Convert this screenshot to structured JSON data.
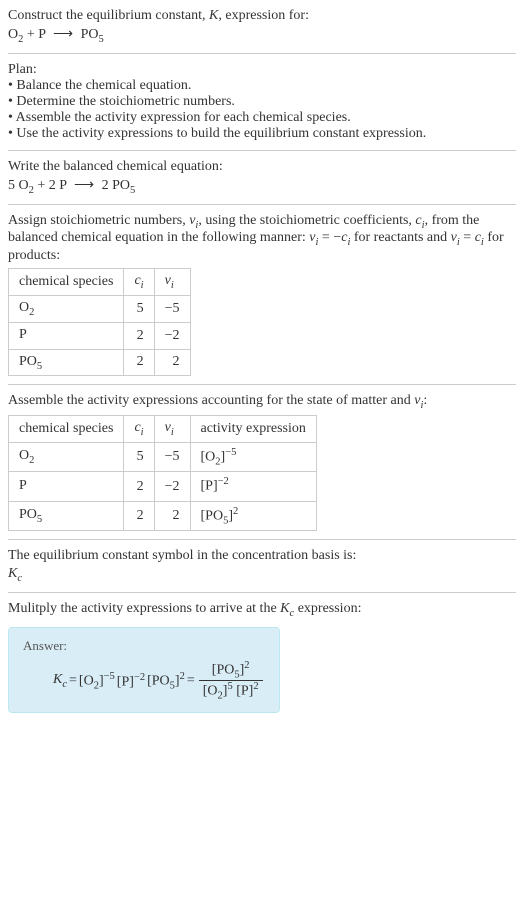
{
  "intro": {
    "line1": "Construct the equilibrium constant, ",
    "k": "K",
    "line1b": ", expression for:",
    "eq_lhs1": "O",
    "eq_sub1": "2",
    "eq_plus": " + P ",
    "eq_arrow": "⟶",
    "eq_rhs": " PO",
    "eq_sub2": "5"
  },
  "plan": {
    "title": "Plan:",
    "items": [
      "Balance the chemical equation.",
      "Determine the stoichiometric numbers.",
      "Assemble the activity expression for each chemical species.",
      "Use the activity expressions to build the equilibrium constant expression."
    ]
  },
  "balanced": {
    "title": "Write the balanced chemical equation:",
    "c1": "5 O",
    "s1": "2",
    "c2": " + 2 P ",
    "arrow": "⟶",
    "c3": " 2 PO",
    "s3": "5"
  },
  "assign": {
    "text1": "Assign stoichiometric numbers, ",
    "nu": "ν",
    "sub_i": "i",
    "text2": ", using the stoichiometric coefficients, ",
    "c": "c",
    "text3": ", from the balanced chemical equation in the following manner: ",
    "rel1a": "ν",
    "rel1b": " = −",
    "rel1c": "c",
    "text4": " for reactants and ",
    "rel2a": "ν",
    "rel2b": " = ",
    "rel2c": "c",
    "text5": " for products:"
  },
  "table1": {
    "h1": "chemical species",
    "h2_a": "c",
    "h2_b": "i",
    "h3_a": "ν",
    "h3_b": "i",
    "rows": [
      {
        "sp_a": "O",
        "sp_b": "2",
        "c": "5",
        "nu": "−5"
      },
      {
        "sp_a": "P",
        "sp_b": "",
        "c": "2",
        "nu": "−2"
      },
      {
        "sp_a": "PO",
        "sp_b": "5",
        "c": "2",
        "nu": "2"
      }
    ]
  },
  "assemble": {
    "text1": "Assemble the activity expressions accounting for the state of matter and ",
    "nu": "ν",
    "sub_i": "i",
    "text2": ":"
  },
  "table2": {
    "h1": "chemical species",
    "h2_a": "c",
    "h2_b": "i",
    "h3_a": "ν",
    "h3_b": "i",
    "h4": "activity expression",
    "rows": [
      {
        "sp_a": "O",
        "sp_b": "2",
        "c": "5",
        "nu": "−5",
        "act_a": "[O",
        "act_b": "2",
        "act_c": "]",
        "act_exp": "−5"
      },
      {
        "sp_a": "P",
        "sp_b": "",
        "c": "2",
        "nu": "−2",
        "act_a": "[P",
        "act_b": "",
        "act_c": "]",
        "act_exp": "−2"
      },
      {
        "sp_a": "PO",
        "sp_b": "5",
        "c": "2",
        "nu": "2",
        "act_a": "[PO",
        "act_b": "5",
        "act_c": "]",
        "act_exp": "2"
      }
    ]
  },
  "symbol": {
    "text": "The equilibrium constant symbol in the concentration basis is:",
    "k": "K",
    "sub": "c"
  },
  "multiply": {
    "text1": "Mulitply the activity expressions to arrive at the ",
    "k": "K",
    "sub": "c",
    "text2": " expression:"
  },
  "answer": {
    "label": "Answer:",
    "k": "K",
    "ksub": "c",
    "eq": " = ",
    "t1a": "[O",
    "t1b": "2",
    "t1c": "]",
    "t1e": "−5",
    "t2a": "[P]",
    "t2e": "−2",
    "t3a": "[PO",
    "t3b": "5",
    "t3c": "]",
    "t3e": "2",
    "eq2": " = ",
    "num_a": "[PO",
    "num_b": "5",
    "num_c": "]",
    "num_e": "2",
    "den1_a": "[O",
    "den1_b": "2",
    "den1_c": "]",
    "den1_e": "5",
    "den2_a": "[P]",
    "den2_e": "2"
  }
}
